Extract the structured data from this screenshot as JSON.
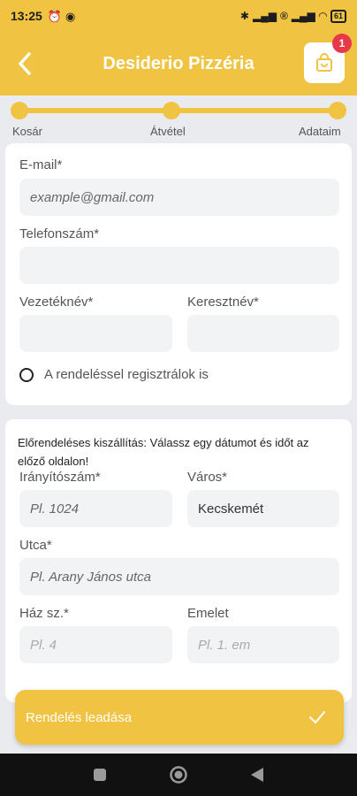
{
  "status": {
    "time": "13:25",
    "battery": "61"
  },
  "header": {
    "title": "Desiderio Pizzéria",
    "cart_count": "1"
  },
  "steps": [
    "Kosár",
    "Átvétel",
    "Adataim"
  ],
  "contact": {
    "email_label": "E-mail*",
    "email_placeholder": "example@gmail.com",
    "phone_label": "Telefonszám*",
    "lastname_label": "Vezetéknév*",
    "firstname_label": "Keresztnév*",
    "register_label": "A rendeléssel regisztrálok is"
  },
  "address": {
    "notice": "Előrendeléses kiszállítás: Válassz egy dátumot és időt az előző oldalon!",
    "zip_label": "Irányítószám*",
    "zip_placeholder": "Pl. 1024",
    "city_label": "Város*",
    "city_value": "Kecskemét",
    "street_label": "Utca*",
    "street_placeholder": "Pl. Arany János utca",
    "house_label": "Ház sz.*",
    "house_placeholder": "Pl. 4",
    "floor_label": "Emelet",
    "floor_placeholder": "Pl. 1. em"
  },
  "actions": {
    "submit_label": "Rendelés leadása"
  },
  "colors": {
    "accent": "#f1c342",
    "badge": "#e8394b"
  }
}
